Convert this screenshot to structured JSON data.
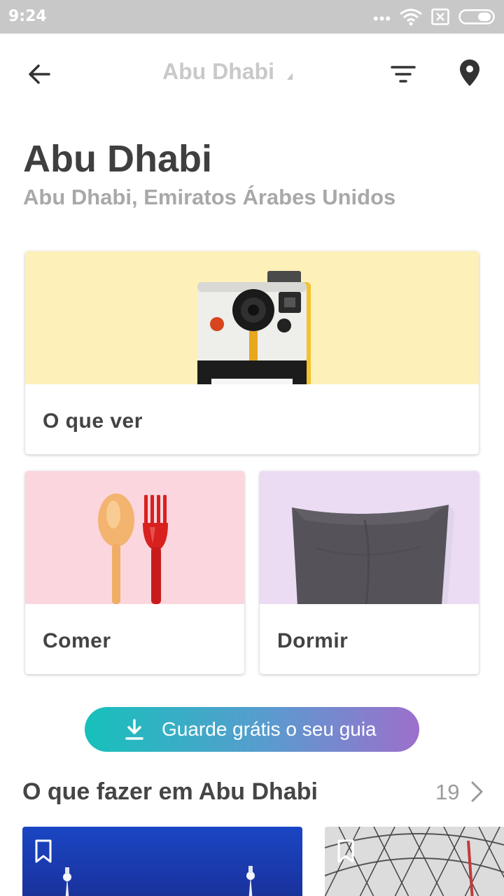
{
  "status_bar": {
    "time": "9:24",
    "signal_dots": "•••",
    "icons": [
      "wifi-icon",
      "sim-error-icon",
      "battery-icon"
    ]
  },
  "app_bar": {
    "title": "Abu Dhabi",
    "icons": [
      "back-arrow-icon",
      "filter-icon",
      "map-pin-icon"
    ]
  },
  "header": {
    "title": "Abu Dhabi",
    "subtitle": "Abu Dhabi, Emiratos Árabes Unidos"
  },
  "categories": [
    {
      "label": "O que ver",
      "bg_color": "#fdf0b8",
      "icon": "camera-illustration"
    },
    {
      "label": "Comer",
      "bg_color": "#fbd6df",
      "icon": "spoon-fork-illustration"
    },
    {
      "label": "Dormir",
      "bg_color": "#ebdcf4",
      "icon": "pillow-illustration"
    }
  ],
  "cta": {
    "label": "Guarde grátis o seu guia",
    "icon": "download-icon",
    "gradient": [
      "#16c1bb",
      "#9d6fcc"
    ]
  },
  "section": {
    "title": "O que fazer em Abu Dhabi",
    "count": "19"
  },
  "colors": {
    "text_primary": "#3f3f3f",
    "text_secondary": "#a8a8a8",
    "status_bar": "#c8c8c8"
  }
}
